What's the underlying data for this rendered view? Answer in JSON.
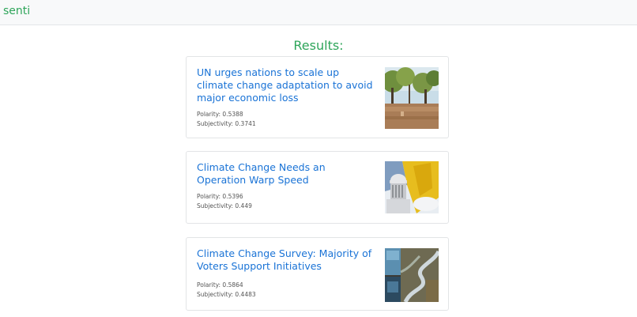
{
  "navbar": {
    "brand": "senti"
  },
  "page": {
    "heading": "Results:"
  },
  "results": [
    {
      "title": "UN urges nations to scale up climate change adaptation to avoid major economic loss",
      "polarity": "Polarity: 0.5388",
      "subjectivity": "Subjectivity: 0.3741",
      "thumbnail": "flood-photo"
    },
    {
      "title": "Climate Change Needs an Operation Warp Speed",
      "polarity": "Polarity: 0.5396",
      "subjectivity": "Subjectivity: 0.449",
      "thumbnail": "capitol-collage-photo"
    },
    {
      "title": "Climate Change Survey: Majority of Voters Support Initiatives",
      "polarity": "Polarity: 0.5864",
      "subjectivity": "Subjectivity: 0.4483",
      "thumbnail": "river-aerial-photo"
    }
  ]
}
